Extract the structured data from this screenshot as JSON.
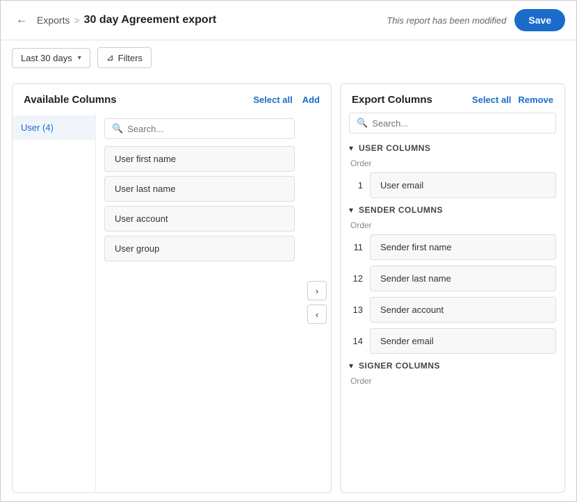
{
  "header": {
    "back_label": "←",
    "breadcrumb_exports": "Exports",
    "breadcrumb_separator": ">",
    "breadcrumb_current": "30 day Agreement export",
    "modified_text": "This report has been modified",
    "save_label": "Save"
  },
  "toolbar": {
    "date_range": "Last 30 days",
    "filters_label": "Filters"
  },
  "available_panel": {
    "title": "Available Columns",
    "select_all_label": "Select all",
    "add_label": "Add",
    "search_placeholder": "Search...",
    "categories": [
      {
        "label": "User (4)",
        "active": true
      }
    ],
    "columns": [
      {
        "label": "User first name"
      },
      {
        "label": "User last name"
      },
      {
        "label": "User account"
      },
      {
        "label": "User group"
      }
    ]
  },
  "export_panel": {
    "title": "Export Columns",
    "select_all_label": "Select all",
    "remove_label": "Remove",
    "search_placeholder": "Search...",
    "sections": [
      {
        "title": "USER COLUMNS",
        "order_label": "Order",
        "items": [
          {
            "order": "1",
            "label": "User email"
          }
        ]
      },
      {
        "title": "SENDER COLUMNS",
        "order_label": "Order",
        "items": [
          {
            "order": "11",
            "label": "Sender first name"
          },
          {
            "order": "12",
            "label": "Sender last name"
          },
          {
            "order": "13",
            "label": "Sender account"
          },
          {
            "order": "14",
            "label": "Sender email"
          }
        ]
      },
      {
        "title": "SIGNER COLUMNS",
        "order_label": "Order",
        "items": []
      }
    ]
  },
  "transfer": {
    "right_arrow": "›",
    "left_arrow": "‹"
  }
}
